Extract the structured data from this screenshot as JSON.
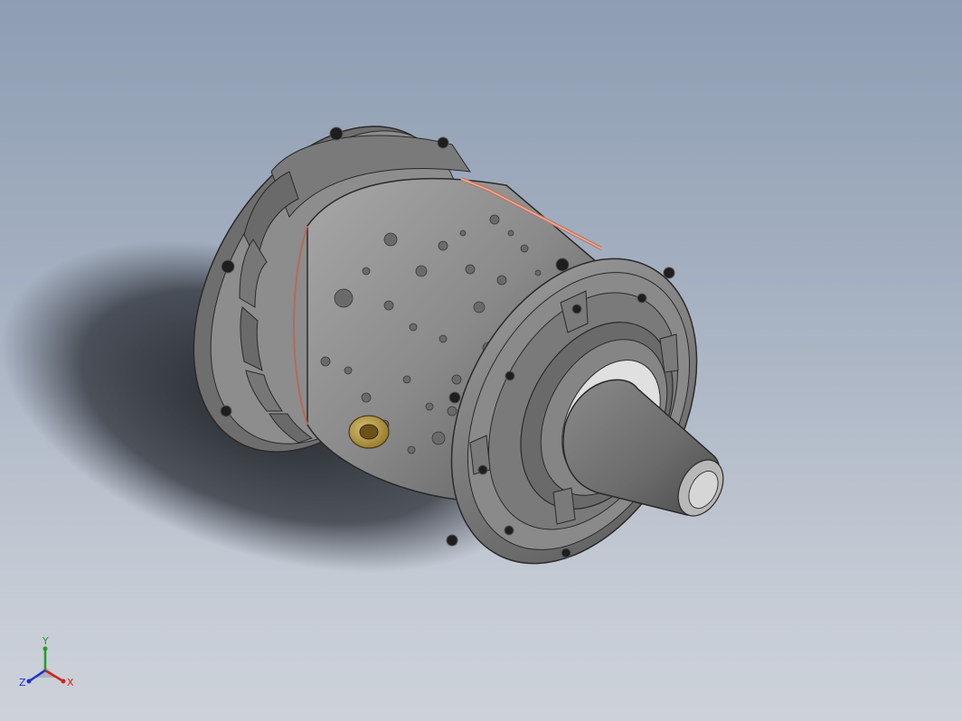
{
  "viewport": {
    "model": "jet-engine-assembly",
    "background_top": "#8e9db3",
    "background_bottom": "#cdd2da"
  },
  "triad": {
    "x_label": "X",
    "y_label": "Y",
    "z_label": "Z",
    "x_color": "#d42020",
    "y_color": "#20a020",
    "z_color": "#2030c8"
  }
}
